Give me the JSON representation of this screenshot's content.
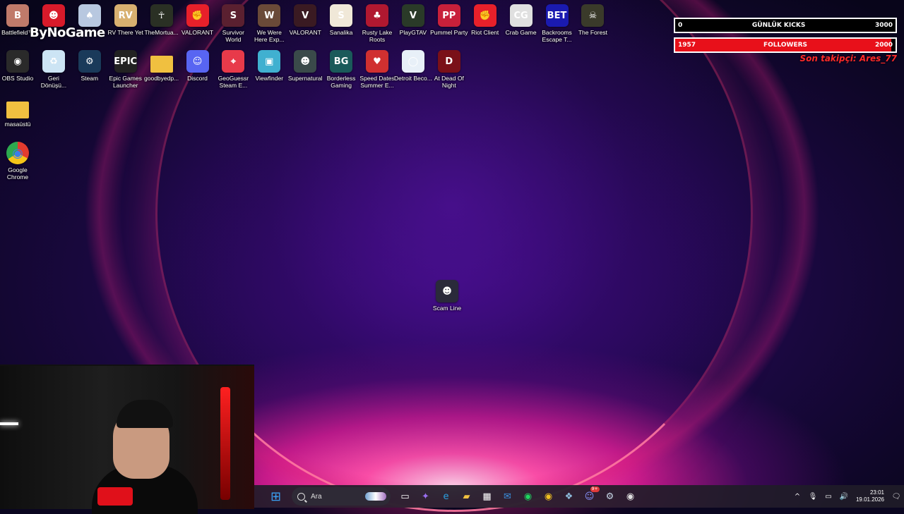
{
  "overlay": {
    "brand_logo": "ByNoGame",
    "kicks_bar": {
      "current": "0",
      "label": "GÜNLÜK KICKS",
      "goal": "3000",
      "progress": 0.0,
      "fill_color": "#000000"
    },
    "followers_bar": {
      "current": "1957",
      "label": "FOLLOWERS",
      "goal": "2000",
      "progress": 0.98,
      "fill_color": "#e8101a"
    },
    "last_follower": "Son takipçi: Ares_77"
  },
  "desktop": {
    "icons": [
      {
        "label": "Battlefield™",
        "icon": "battlefield-icon",
        "color": "#c07a6a",
        "glyph": "B"
      },
      {
        "label": "",
        "icon": "red-character-icon",
        "color": "#d81a2a",
        "glyph": "☻"
      },
      {
        "label": "",
        "icon": "card-game-icon",
        "color": "#b8c8e0",
        "glyph": "♠"
      },
      {
        "label": "RV There Yet",
        "icon": "rv-there-yet-icon",
        "color": "#d8b070",
        "glyph": "RV"
      },
      {
        "label": "TheMortua...",
        "icon": "mortuary-icon",
        "color": "#2a3024",
        "glyph": "☥"
      },
      {
        "label": "VALORANT",
        "icon": "riot-icon",
        "color": "#e8202a",
        "glyph": "✊"
      },
      {
        "label": "Survivor World",
        "icon": "survivor-world-icon",
        "color": "#5a2030",
        "glyph": "S"
      },
      {
        "label": "We Were Here Exp...",
        "icon": "we-were-here-icon",
        "color": "#6a4a38",
        "glyph": "W"
      },
      {
        "label": "VALORANT",
        "icon": "valorant-icon",
        "color": "#3a1a22",
        "glyph": "V"
      },
      {
        "label": "Sanalika",
        "icon": "sanalika-icon",
        "color": "#f0e8d8",
        "glyph": "S"
      },
      {
        "label": "Rusty Lake Roots",
        "icon": "rusty-lake-icon",
        "color": "#b01830",
        "glyph": "♣"
      },
      {
        "label": "PlayGTAV",
        "icon": "gtav-icon",
        "color": "#2a3a28",
        "glyph": "V"
      },
      {
        "label": "Pummel Party",
        "icon": "pummel-party-icon",
        "color": "#c8203a",
        "glyph": "PP"
      },
      {
        "label": "Riot Client",
        "icon": "riot-client-icon",
        "color": "#e8202a",
        "glyph": "✊"
      },
      {
        "label": "Crab Game",
        "icon": "crab-game-icon",
        "color": "#e0e0e0",
        "glyph": "CG"
      },
      {
        "label": "Backrooms Escape T...",
        "icon": "backrooms-icon",
        "color": "#1a1ab0",
        "glyph": "BET"
      },
      {
        "label": "The Forest",
        "icon": "the-forest-icon",
        "color": "#3a3a2a",
        "glyph": "☠"
      },
      {
        "label": "OBS Studio",
        "icon": "obs-icon",
        "color": "#2a2a2a",
        "glyph": "◉"
      },
      {
        "label": "Geri Dönüşü...",
        "icon": "recycle-bin-icon",
        "color": "#cce4f4",
        "glyph": "♻"
      },
      {
        "label": "Steam",
        "icon": "steam-icon",
        "color": "#1a3a5a",
        "glyph": "⚙"
      },
      {
        "label": "Epic Games Launcher",
        "icon": "epic-games-icon",
        "color": "#222222",
        "glyph": "EPIC"
      },
      {
        "label": "goodbyedp...",
        "icon": "folder-icon",
        "color": "#f0c040",
        "glyph": ""
      },
      {
        "label": "Discord",
        "icon": "discord-icon",
        "color": "#5865f2",
        "glyph": "☺"
      },
      {
        "label": "GeoGuessr Steam E...",
        "icon": "geoguessr-icon",
        "color": "#e83a4a",
        "glyph": "⌖"
      },
      {
        "label": "Viewfinder",
        "icon": "viewfinder-icon",
        "color": "#40b0d0",
        "glyph": "▣"
      },
      {
        "label": "Supernatural",
        "icon": "supernatural-icon",
        "color": "#3a4a4a",
        "glyph": "☻"
      },
      {
        "label": "Borderless Gaming",
        "icon": "borderless-gaming-icon",
        "color": "#1a5a5a",
        "glyph": "BG"
      },
      {
        "label": "Speed Dates Summer E...",
        "icon": "speed-dates-icon",
        "color": "#d03030",
        "glyph": "♥"
      },
      {
        "label": "Detroit Beco...",
        "icon": "detroit-icon",
        "color": "#e8f0f8",
        "glyph": "◯"
      },
      {
        "label": "At Dead Of Night",
        "icon": "at-dead-of-night-icon",
        "color": "#7a1018",
        "glyph": "D"
      },
      {
        "label": "masaüstü",
        "icon": "folder-icon",
        "color": "#f0c040",
        "glyph": ""
      },
      {
        "label": "Google Chrome",
        "icon": "chrome-icon",
        "color": "#ffffff",
        "glyph": "◉"
      },
      {
        "label": "Scam Line",
        "icon": "scam-line-icon",
        "color": "#2a2a3a",
        "glyph": "☻"
      }
    ]
  },
  "taskbar": {
    "search_placeholder": "Ara",
    "apps": [
      {
        "icon": "windows-start-icon",
        "glyph": "⊞",
        "color": "#3a9ff0"
      },
      {
        "icon": "task-view-icon",
        "glyph": "▭",
        "color": "#ffffff"
      },
      {
        "icon": "copilot-icon",
        "glyph": "✦",
        "color": "#9a6ff0"
      },
      {
        "icon": "edge-icon",
        "glyph": "e",
        "color": "#2aa0e0"
      },
      {
        "icon": "file-explorer-icon",
        "glyph": "▰",
        "color": "#f0c040"
      },
      {
        "icon": "ms-store-icon",
        "glyph": "▦",
        "color": "#ffffff"
      },
      {
        "icon": "mail-icon",
        "glyph": "✉",
        "color": "#3a90e0"
      },
      {
        "icon": "spotify-icon",
        "glyph": "◉",
        "color": "#1ed760"
      },
      {
        "icon": "chrome-icon",
        "glyph": "◉",
        "color": "#f0c020"
      },
      {
        "icon": "app-settings-icon",
        "glyph": "❖",
        "color": "#90c0e0"
      },
      {
        "icon": "discord-icon",
        "glyph": "☺",
        "color": "#8a95ff",
        "badge": "9+"
      },
      {
        "icon": "steam-icon",
        "glyph": "⚙",
        "color": "#c8d8e8"
      },
      {
        "icon": "obs-icon",
        "glyph": "◉",
        "color": "#e0e0e0",
        "badge": ""
      }
    ],
    "tray": {
      "chevron": "^",
      "mic": "🎙",
      "network": "▭",
      "volume": "🔊",
      "time": "23:01",
      "date": "19.01.2026",
      "notification": "🗨"
    }
  }
}
